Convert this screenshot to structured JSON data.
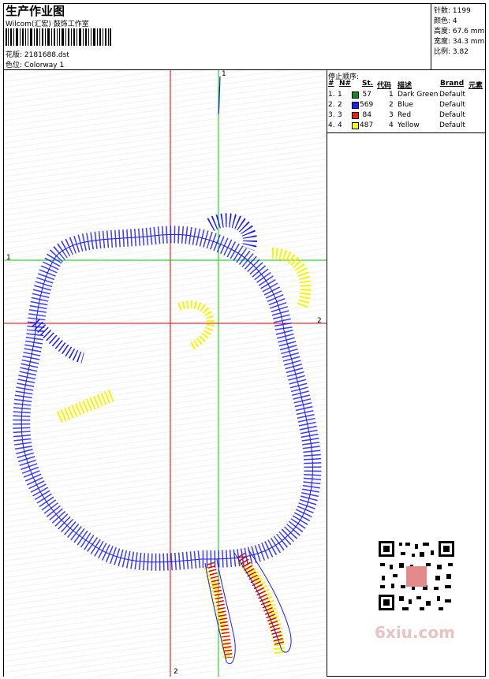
{
  "header": {
    "title": "生产作业图",
    "company": "Wilcom(汇宏) 鼓饰工作室",
    "design_label": "花版:",
    "design_file": "2181688.dst",
    "colorway_label": "色位:",
    "colorway": "Colorway 1"
  },
  "stats": {
    "stitches": "针数: 1199",
    "colors": "颜色: 4",
    "height": "高度: 67.6 mm",
    "width": "宽度: 34.3 mm",
    "scale": "比例: 3.82"
  },
  "stop_sequence": {
    "title": "停止顺序:",
    "headers": [
      "#",
      "N#",
      "St.",
      "代码",
      "描述",
      "Brand",
      "元素"
    ],
    "rows": [
      {
        "idx": "1.",
        "n": "1",
        "st": "57",
        "code": "1",
        "desc": "Dark Green",
        "brand": "Default",
        "color": "#0f8a1e"
      },
      {
        "idx": "2.",
        "n": "2",
        "st": "569",
        "code": "2",
        "desc": "Blue",
        "brand": "Default",
        "color": "#1a1aff"
      },
      {
        "idx": "3.",
        "n": "3",
        "st": "84",
        "code": "3",
        "desc": "Red",
        "brand": "Default",
        "color": "#ee1c1c"
      },
      {
        "idx": "4.",
        "n": "4",
        "st": "487",
        "code": "4",
        "desc": "Yellow",
        "brand": "Default",
        "color": "#ffff00"
      }
    ]
  },
  "canvas": {
    "axis_labels": {
      "green_top": "1",
      "green_left": "1",
      "red_right": "2",
      "red_bottom": "2"
    }
  },
  "watermark": "6xiu.com"
}
